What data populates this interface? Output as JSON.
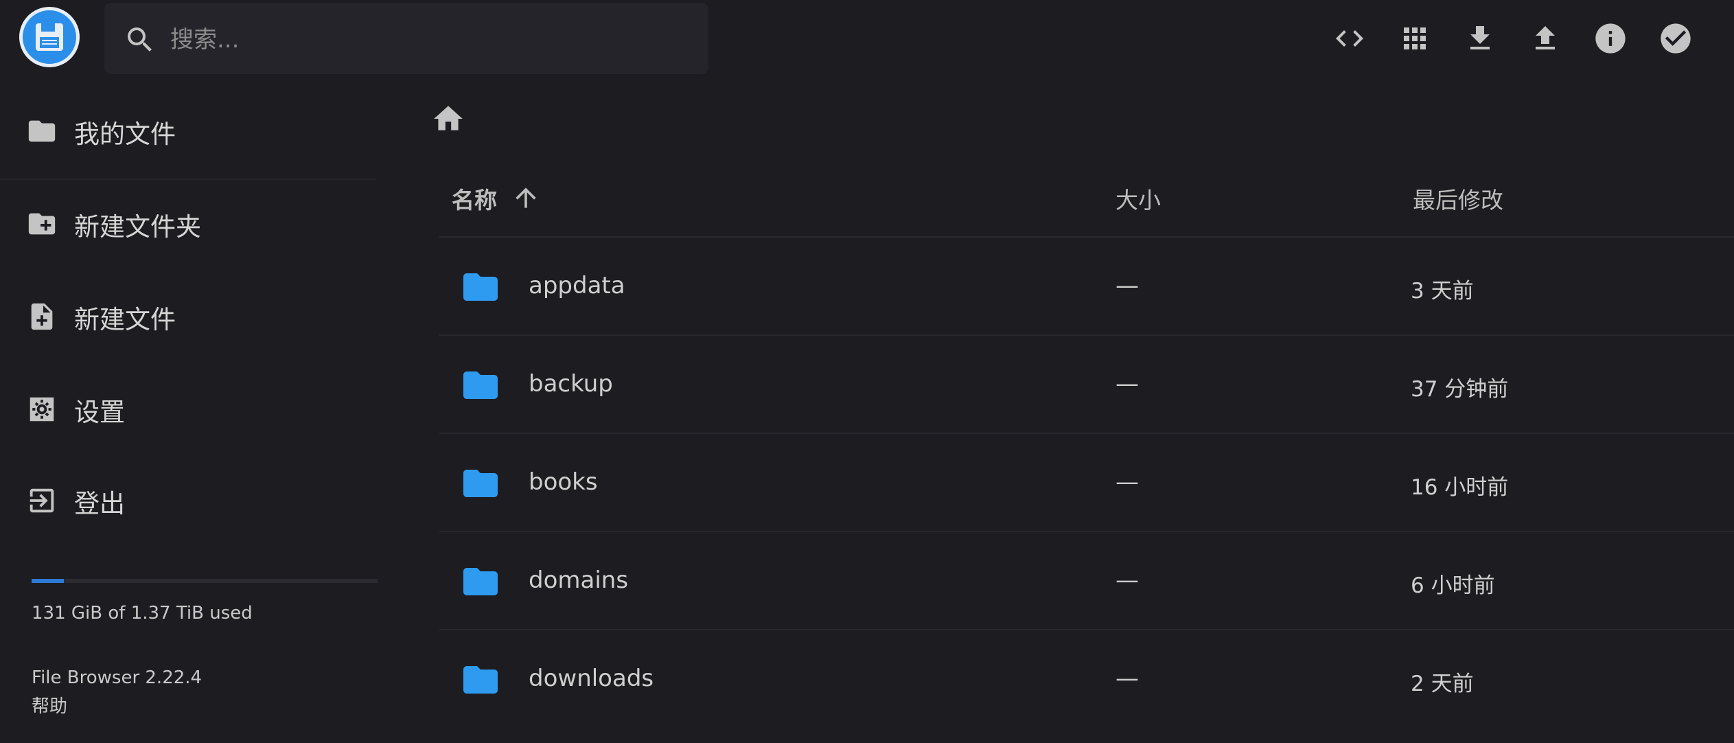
{
  "app": {
    "logo_icon": "floppy-disk-icon",
    "accent": "#2b8fea"
  },
  "search": {
    "placeholder": "搜索..."
  },
  "toolbar": {
    "items": [
      {
        "name": "view-source-icon"
      },
      {
        "name": "grid-view-icon"
      },
      {
        "name": "download-icon"
      },
      {
        "name": "upload-icon"
      },
      {
        "name": "info-icon"
      },
      {
        "name": "select-check-icon"
      }
    ]
  },
  "sidebar": {
    "items": [
      {
        "label": "我的文件",
        "icon": "folder-icon"
      },
      {
        "label": "新建文件夹",
        "icon": "new-folder-icon"
      },
      {
        "label": "新建文件",
        "icon": "new-file-icon"
      },
      {
        "label": "设置",
        "icon": "settings-icon"
      },
      {
        "label": "登出",
        "icon": "logout-icon"
      }
    ],
    "quota": {
      "text": "131 GiB of 1.37 TiB used",
      "fraction": 0.093
    },
    "version": "File Browser 2.22.4",
    "help": "帮助"
  },
  "listing": {
    "columns": {
      "name": "名称",
      "size": "大小",
      "modified": "最后修改"
    },
    "sort": "ascending",
    "rows": [
      {
        "name": "appdata",
        "size": "—",
        "modified": "3 天前"
      },
      {
        "name": "backup",
        "size": "—",
        "modified": "37 分钟前"
      },
      {
        "name": "books",
        "size": "—",
        "modified": "16 小时前"
      },
      {
        "name": "domains",
        "size": "—",
        "modified": "6 小时前"
      },
      {
        "name": "downloads",
        "size": "—",
        "modified": "2 天前"
      }
    ]
  },
  "colors": {
    "folder": "#2e9bf0",
    "background": "#1d1c21",
    "quota_bar": "#2b7ad6"
  }
}
